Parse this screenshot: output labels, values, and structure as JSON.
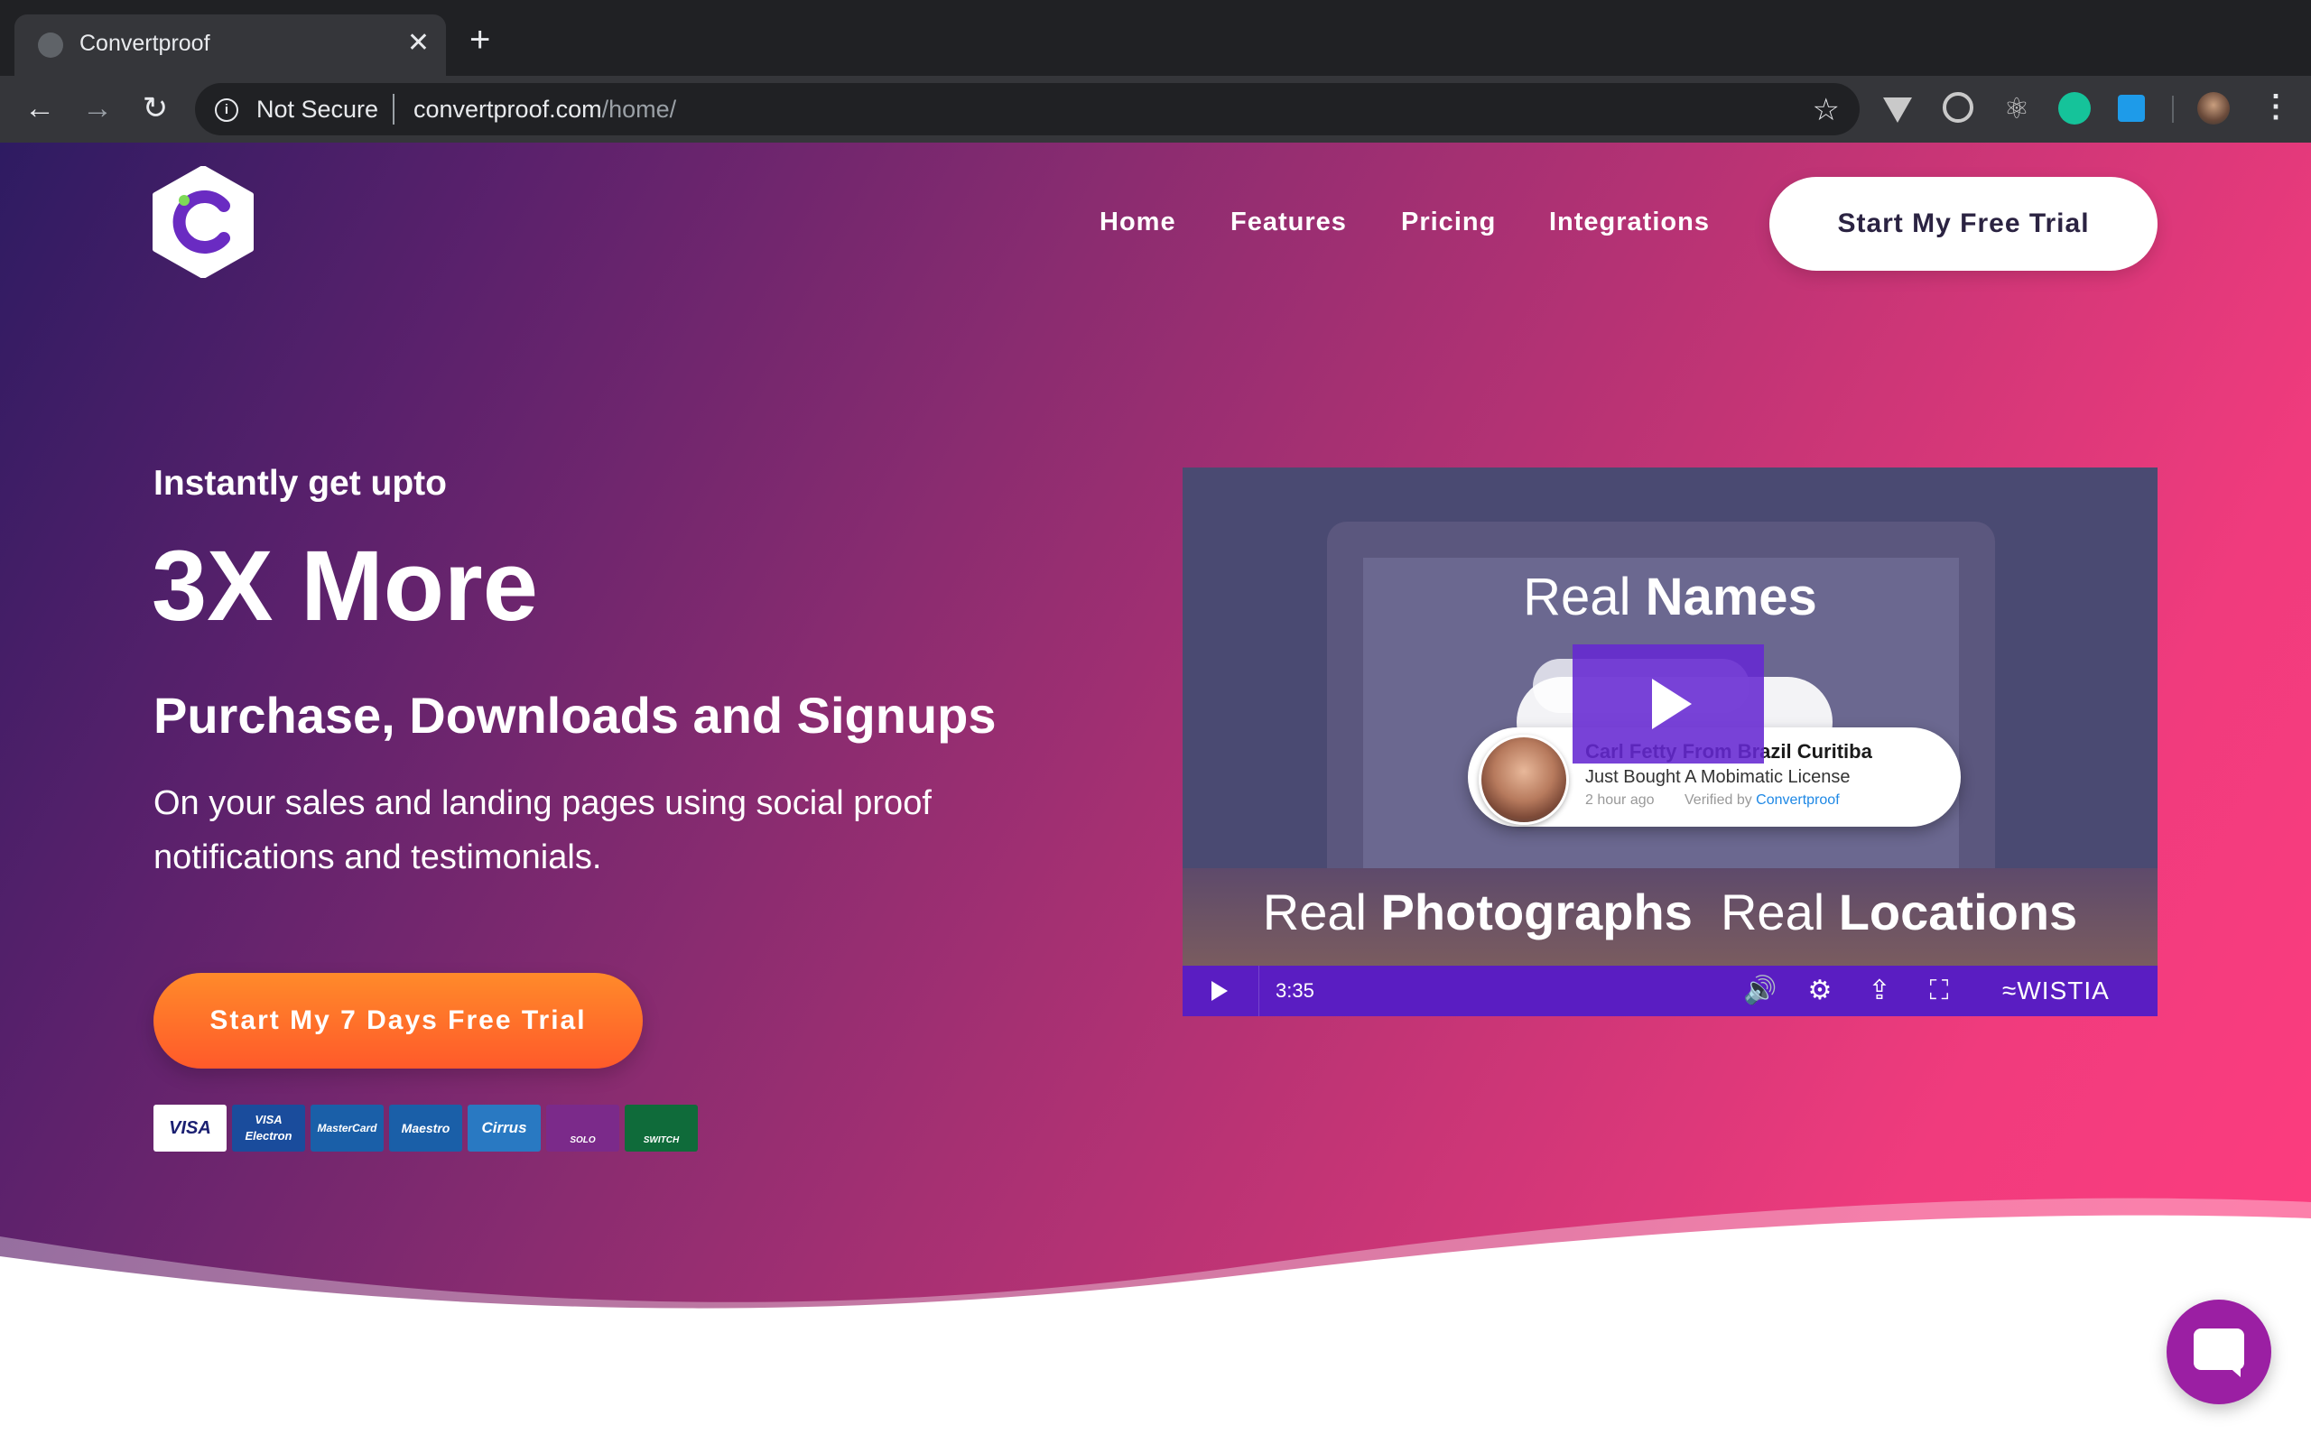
{
  "browser": {
    "tab_title": "Convertproof",
    "security_label": "Not Secure",
    "url_host": "convertproof.com",
    "url_path": "/home/"
  },
  "nav": {
    "items": [
      "Home",
      "Features",
      "Pricing",
      "Integrations"
    ],
    "cta": "Start My Free Trial"
  },
  "hero": {
    "kicker": "Instantly get upto",
    "headline": "3X More",
    "subhead": "Purchase, Downloads and Signups",
    "body": "On your sales and landing pages using social proof notifications and testimonials.",
    "cta": "Start My 7 Days Free Trial"
  },
  "payment_cards": [
    {
      "label": "VISA",
      "color": "#ffffff",
      "text_color": "#1a1f71"
    },
    {
      "label": "VISA Electron",
      "color": "#1a4c9c",
      "text_color": "#ffffff"
    },
    {
      "label": "MasterCard",
      "color": "#1a5fa8",
      "text_color": "#ffffff"
    },
    {
      "label": "Maestro",
      "color": "#1a5fa8",
      "text_color": "#ffffff"
    },
    {
      "label": "Cirrus",
      "color": "#2979c2",
      "text_color": "#ffffff"
    },
    {
      "label": "SOLO",
      "color": "#7b2a8a",
      "text_color": "#ffffff"
    },
    {
      "label": "SWITCH",
      "color": "#0f6b3a",
      "text_color": "#ffffff"
    }
  ],
  "video": {
    "caption_top_light": "Real ",
    "caption_top_bold": "Names",
    "caption_bottom_light1": "Real ",
    "caption_bottom_bold1": "Photographs",
    "caption_bottom_light2": "  Real ",
    "caption_bottom_bold2": "Locations",
    "notification": {
      "name": "Carl Fetty From Brazil Curitiba",
      "action": "Just Bought A Mobimatic License",
      "time": "2 hour ago",
      "verified_prefix": "Verified by ",
      "verified_brand": "Convertproof"
    },
    "duration": "3:35",
    "brand": "WISTIA"
  },
  "colors": {
    "accent_purple": "#5a1dc2",
    "cta_orange": "#ff6a2a",
    "hero_gradient_start": "#2e1b62",
    "hero_gradient_end": "#ff3d7f",
    "chat_purple": "#9b1fa3"
  }
}
